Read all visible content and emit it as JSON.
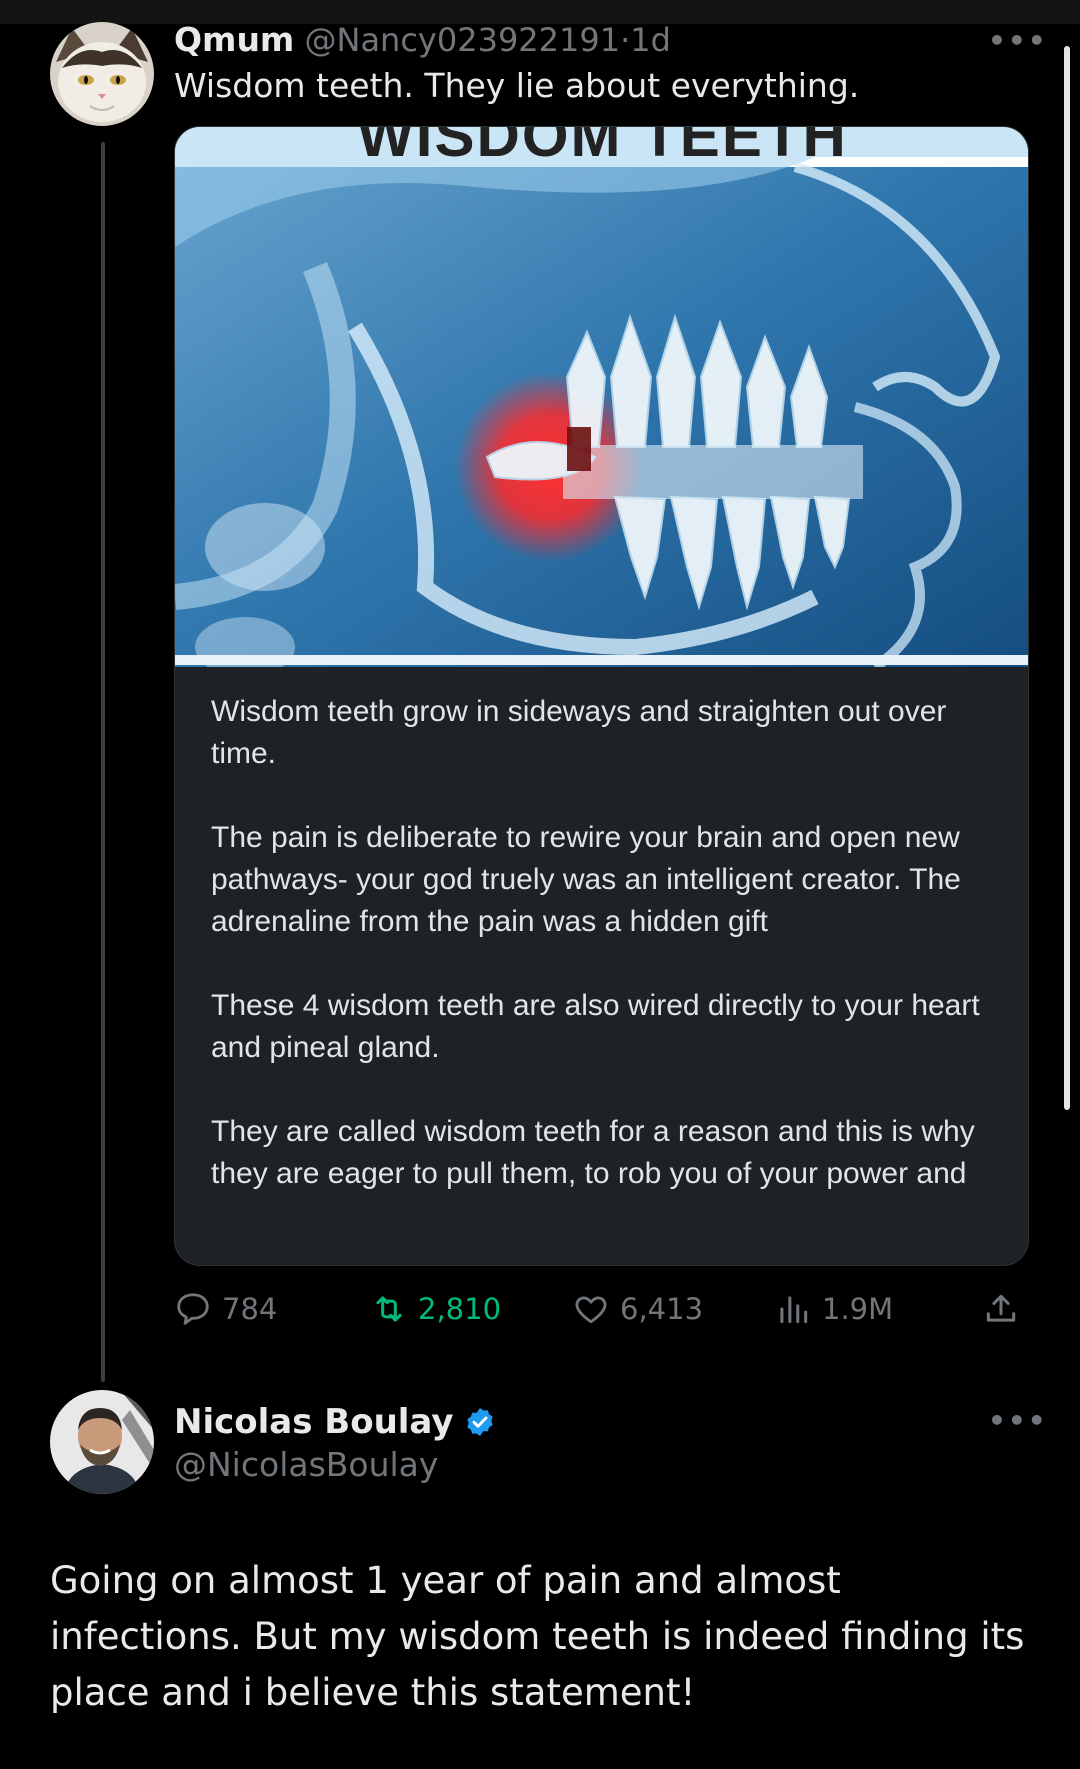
{
  "tweet1": {
    "author_name": "Qmum",
    "author_handle": "@Nancy023922191",
    "separator": "·",
    "time": "1d",
    "text": "Wisdom teeth. They lie about everything.",
    "media": {
      "title": "WISDOM TEETH",
      "paragraphs": [
        "Wisdom teeth grow in sideways and straighten out over time.",
        "The pain is deliberate to rewire your brain and open new pathways- your god truely was an intelligent creator.  The adrenaline from the pain was a hidden gift",
        "These 4 wisdom teeth are also wired directly to your heart and pineal gland.",
        "They are called wisdom teeth for a reason and this is why they are eager to pull them, to rob you of your power and true potential"
      ]
    },
    "stats": {
      "replies": "784",
      "retweets": "2,810",
      "likes": "6,413",
      "views": "1.9M"
    },
    "more_label": "•••"
  },
  "tweet2": {
    "author_name": "Nicolas Boulay",
    "author_handle": "@NicolasBoulay",
    "text": "Going on almost 1 year of pain and almost infections. But my wisdom teeth is indeed finding its place and i believe this statement!",
    "more_label": "•••"
  },
  "colors": {
    "background": "#000000",
    "text_primary": "#e7e9ea",
    "text_secondary": "#71767b",
    "retweet_green": "#00ba7c",
    "verified_blue": "#1d9bf0"
  },
  "icons": {
    "reply": "reply-icon",
    "retweet": "retweet-icon",
    "like": "heart-icon",
    "views": "views-icon",
    "share": "share-icon",
    "verified": "verified-badge-icon"
  }
}
